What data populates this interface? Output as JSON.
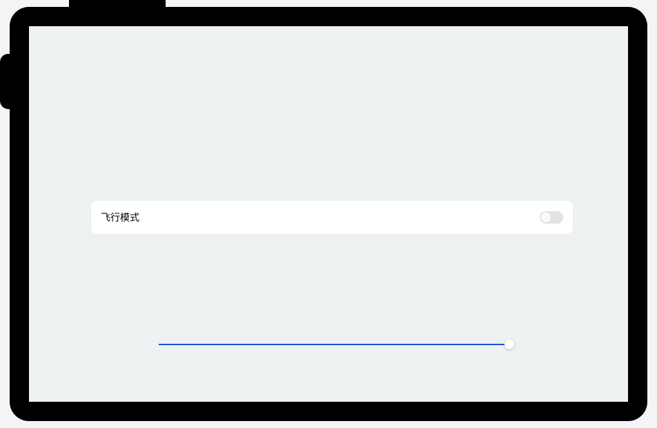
{
  "settings": {
    "airplane_mode": {
      "label": "飞行模式",
      "enabled": false
    }
  },
  "slider": {
    "value": 100,
    "min": 0,
    "max": 100
  }
}
